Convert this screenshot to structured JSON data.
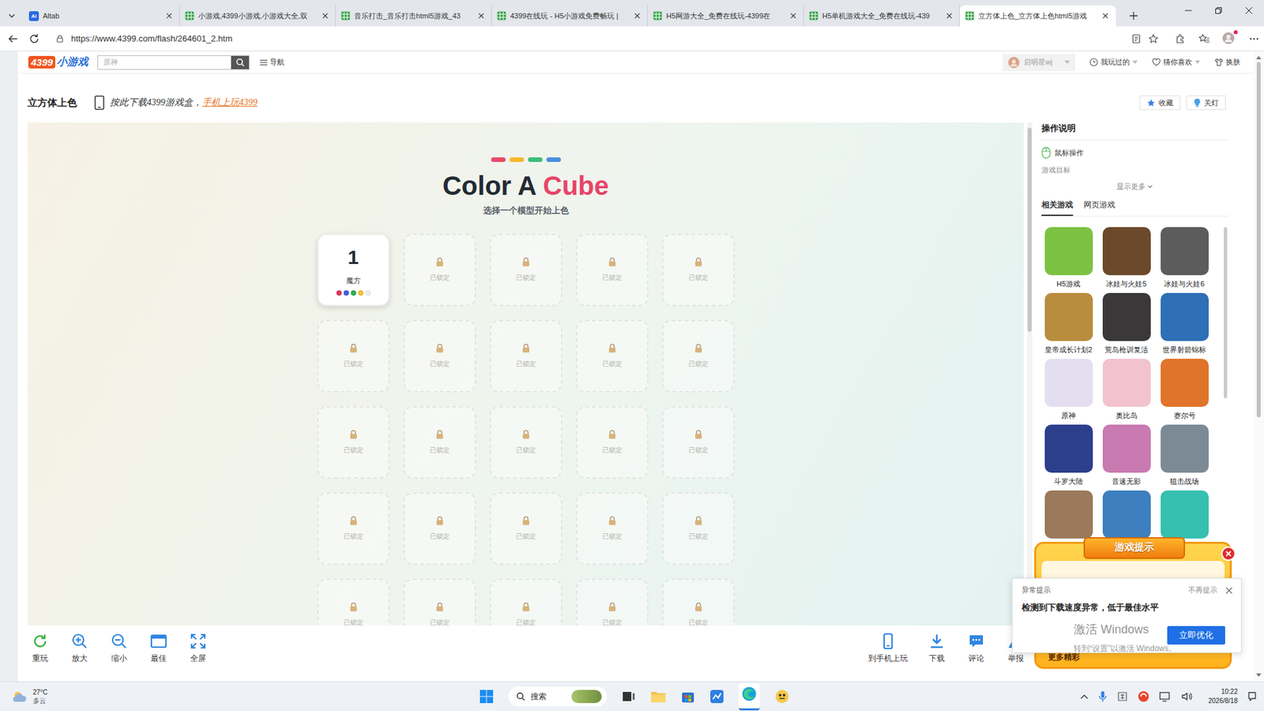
{
  "browser": {
    "tabs": [
      {
        "label": "Altab",
        "icon_text": "Ai",
        "selected": false
      },
      {
        "label": "小游戏,4399小游戏,小游戏大全,双",
        "selected": false
      },
      {
        "label": "音乐打击_音乐打击html5游戏_43",
        "selected": false
      },
      {
        "label": "4399在线玩 - H5小游戏免费畅玩 |",
        "selected": false
      },
      {
        "label": "H5网游大全_免费在线玩-4399在",
        "selected": false
      },
      {
        "label": "H5单机游戏大全_免费在线玩-439",
        "selected": false
      },
      {
        "label": "立方体上色_立方体上色html5游戏",
        "selected": true
      }
    ],
    "address": "https://www.4399.com/flash/264601_2.htm"
  },
  "site_header": {
    "logo_number": "4399",
    "logo_text": "小游戏",
    "search_placeholder": "原神",
    "nav": "导航",
    "user": "启明星wj",
    "links": [
      {
        "label": "我玩过的",
        "kind": "clock",
        "dropdown": true
      },
      {
        "label": "猜你喜欢",
        "kind": "heart",
        "dropdown": true
      },
      {
        "label": "换肤",
        "kind": "shirt",
        "dropdown": false
      }
    ]
  },
  "game_header": {
    "title": "立方体上色",
    "promo": "按此下载4399游戏盒，",
    "promo_highlight": "手机上玩4399",
    "buttons": [
      {
        "label": "收藏",
        "kind": "star"
      },
      {
        "label": "关灯",
        "kind": "bulb"
      }
    ]
  },
  "game": {
    "accent_bars": [
      {
        "color": "#e84a6a"
      },
      {
        "color": "#f5b82e"
      },
      {
        "color": "#3cbf7a"
      },
      {
        "color": "#4a8fe0"
      }
    ],
    "title_part1": "Color A ",
    "title_part2": "Cube",
    "subtitle": "选择一个模型开始上色",
    "levels": [
      {
        "number": "1",
        "name": "魔方",
        "locked": false,
        "dots": [
          {
            "color": "#d9365e"
          },
          {
            "color": "#3f5fd8"
          },
          {
            "color": "#2fae57"
          },
          {
            "color": "#f2c233"
          },
          {
            "color": "#eeeeee"
          }
        ]
      },
      {
        "label": "已锁定",
        "locked": true
      },
      {
        "label": "已锁定",
        "locked": true
      },
      {
        "label": "已锁定",
        "locked": true
      },
      {
        "label": "已锁定",
        "locked": true
      },
      {
        "label": "已锁定",
        "locked": true
      },
      {
        "label": "已锁定",
        "locked": true
      },
      {
        "label": "已锁定",
        "locked": true
      },
      {
        "label": "已锁定",
        "locked": true
      },
      {
        "label": "已锁定",
        "locked": true
      },
      {
        "label": "已锁定",
        "locked": true
      },
      {
        "label": "已锁定",
        "locked": true
      },
      {
        "label": "已锁定",
        "locked": true
      },
      {
        "label": "已锁定",
        "locked": true
      },
      {
        "label": "已锁定",
        "locked": true
      },
      {
        "label": "已锁定",
        "locked": true
      },
      {
        "label": "已锁定",
        "locked": true
      },
      {
        "label": "已锁定",
        "locked": true
      },
      {
        "label": "已锁定",
        "locked": true
      },
      {
        "label": "已锁定",
        "locked": true
      },
      {
        "label": "已锁定",
        "locked": true
      },
      {
        "label": "已锁定",
        "locked": true
      },
      {
        "label": "已锁定",
        "locked": true
      },
      {
        "label": "已锁定",
        "locked": true
      },
      {
        "label": "已锁定",
        "locked": true
      }
    ]
  },
  "toolbar": {
    "left": [
      {
        "label": "重玩",
        "kind": "reload"
      },
      {
        "label": "放大",
        "kind": "zoom-in"
      },
      {
        "label": "缩小",
        "kind": "zoom-out"
      },
      {
        "label": "最佳",
        "kind": "best"
      },
      {
        "label": "全屏",
        "kind": "fullscreen"
      }
    ],
    "right": [
      {
        "label": "到手机上玩",
        "kind": "phone"
      },
      {
        "label": "下载",
        "kind": "download"
      },
      {
        "label": "评论",
        "kind": "comment"
      },
      {
        "label": "举报",
        "kind": "report"
      }
    ]
  },
  "side_panel": {
    "title": "操作说明",
    "control": "鼠标操作",
    "goal": "游戏目标",
    "more": "显示更多",
    "tabs": [
      {
        "label": "相关游戏",
        "selected": true
      },
      {
        "label": "网页游戏",
        "selected": false
      }
    ],
    "games": [
      {
        "label": "H5游戏",
        "color": "#7cc242"
      },
      {
        "label": "冰娃与火娃5",
        "color": "#6b4a2b"
      },
      {
        "label": "冰娃与火娃6",
        "color": "#5c5c5c"
      },
      {
        "label": "皇帝成长计划2",
        "color": "#b98d3e"
      },
      {
        "label": "荒岛枪训复活",
        "color": "#3a3838"
      },
      {
        "label": "世界射箭锦标",
        "color": "#2f6fb5"
      },
      {
        "label": "原神",
        "color": "#e3dff0"
      },
      {
        "label": "奥比岛",
        "color": "#f2c3cf"
      },
      {
        "label": "赛尔号",
        "color": "#e0742a"
      },
      {
        "label": "斗罗大陆",
        "color": "#2b3f8c"
      },
      {
        "label": "音速无影",
        "color": "#c97ab0"
      },
      {
        "label": "狙击战场",
        "color": "#7c8a96"
      },
      {
        "color": "#9a7a5a"
      },
      {
        "color": "#3d7fbf"
      },
      {
        "color": "#35c0b0"
      }
    ]
  },
  "popup": {
    "title": "游戏提示",
    "footer": "更多精彩"
  },
  "notification": {
    "title": "异常提示",
    "dismiss": "不再提示",
    "message": "检测到下载速度异常，低于最佳水平",
    "button": "立即优化"
  },
  "watermark": {
    "line1": "激活 Windows",
    "line2": "转到“设置”以激活 Windows。"
  },
  "taskbar": {
    "weather": {
      "temp": "27°C",
      "desc": "多云"
    },
    "search": "搜索",
    "clock": {
      "time": "10:22",
      "date": "2026/8/18"
    }
  }
}
